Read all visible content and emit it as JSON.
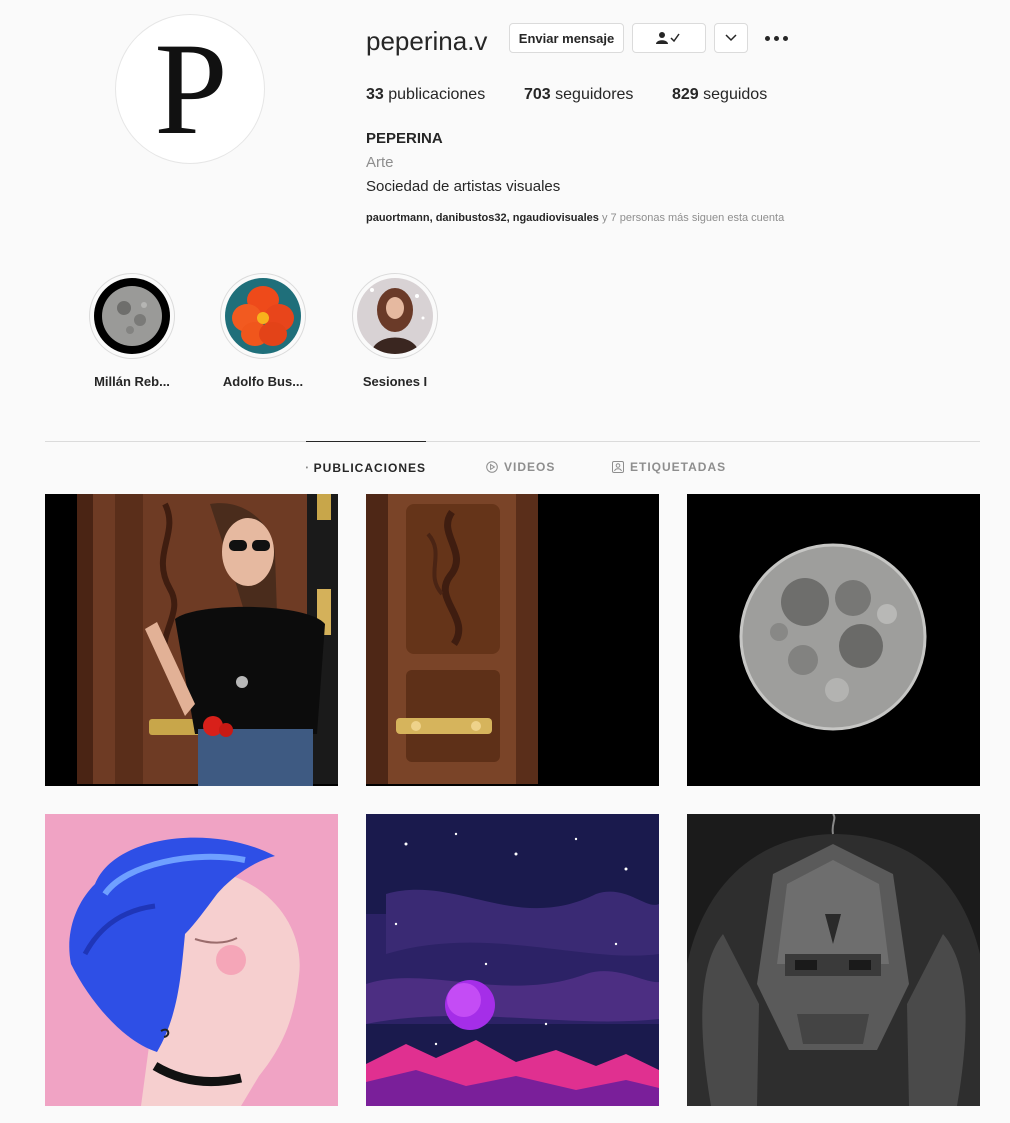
{
  "profile": {
    "avatar_letter": "P",
    "username": "peperina.v",
    "buttons": {
      "message": "Enviar mensaje"
    },
    "stats": {
      "posts_count": "33",
      "posts_label": " publicaciones",
      "followers_count": "703",
      "followers_label": " seguidores",
      "following_count": "829",
      "following_label": " seguidos"
    },
    "full_name": "PEPERINA",
    "category": "Arte",
    "bio": "Sociedad de artistas visuales",
    "followed_by": {
      "users": [
        "pauortmann",
        "danibustos32",
        "ngaudiovisuales"
      ],
      "suffix": " y 7 personas más siguen esta cuenta"
    }
  },
  "highlights": [
    {
      "label": "Millán Reb...",
      "icon": "moon"
    },
    {
      "label": "Adolfo Bus...",
      "icon": "red-flower"
    },
    {
      "label": "Sesiones I",
      "icon": "portrait"
    }
  ],
  "tabs": [
    {
      "label": "PUBLICACIONES",
      "icon": "grid-icon",
      "active": true
    },
    {
      "label": "VIDEOS",
      "icon": "play-icon",
      "active": false
    },
    {
      "label": "ETIQUETADAS",
      "icon": "tag-icon",
      "active": false
    }
  ],
  "posts": [
    {
      "subject": "woman-by-wooden-door"
    },
    {
      "subject": "carved-wooden-door"
    },
    {
      "subject": "full-moon"
    },
    {
      "subject": "blue-haired-illustration"
    },
    {
      "subject": "purple-planet-night-sky"
    },
    {
      "subject": "armored-robot-portrait"
    }
  ],
  "colors": {
    "text": "#262626",
    "muted": "#8e8e8e",
    "border": "#dbdbdb",
    "background": "#fafafa"
  }
}
